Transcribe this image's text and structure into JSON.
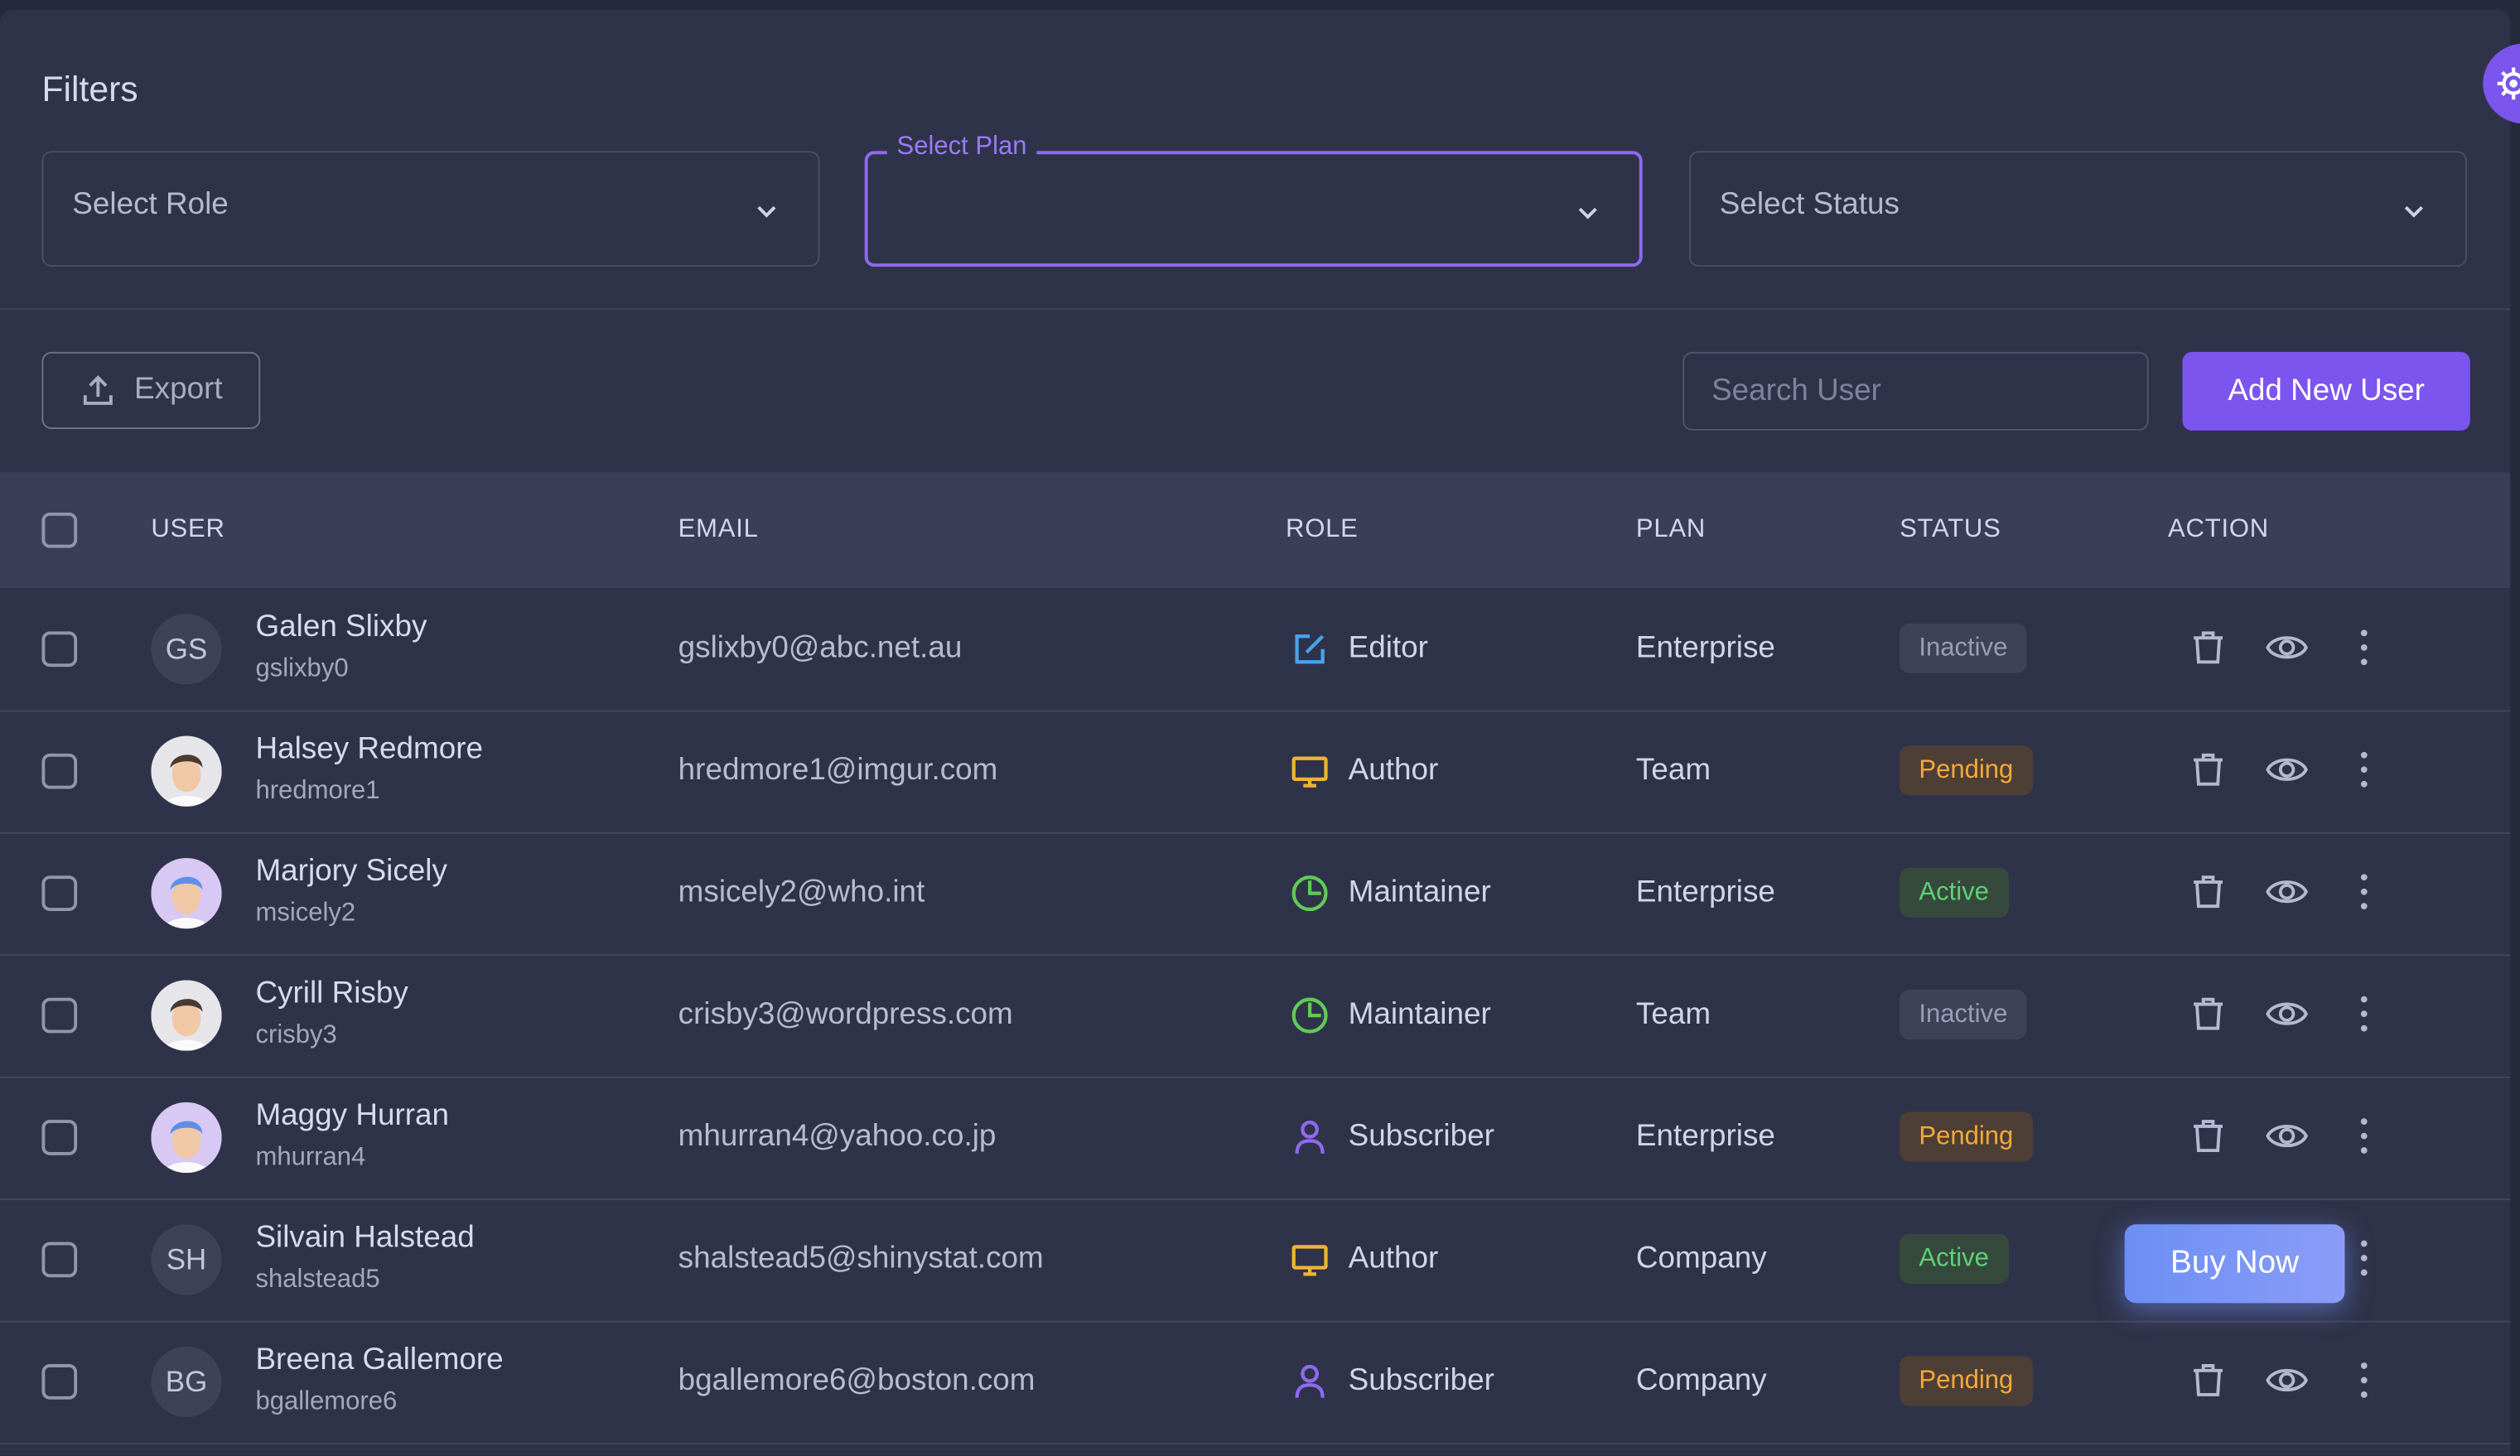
{
  "filters": {
    "title": "Filters",
    "role_placeholder": "Select Role",
    "plan_label": "Select Plan",
    "status_placeholder": "Select Status"
  },
  "toolbar": {
    "export_label": "Export",
    "search_placeholder": "Search User",
    "add_label": "Add New User"
  },
  "table": {
    "headers": {
      "user": "USER",
      "email": "EMAIL",
      "role": "ROLE",
      "plan": "PLAN",
      "status": "STATUS",
      "action": "ACTION"
    },
    "rows": [
      {
        "initials": "GS",
        "avatar": "initials",
        "name": "Galen Slixby",
        "handle": "gslixby0",
        "email": "gslixby0@abc.net.au",
        "role": "Editor",
        "role_icon": "edit-icon",
        "plan": "Enterprise",
        "status": "Inactive"
      },
      {
        "initials": "",
        "avatar": "photo-man",
        "name": "Halsey Redmore",
        "handle": "hredmore1",
        "email": "hredmore1@imgur.com",
        "role": "Author",
        "role_icon": "monitor-icon",
        "plan": "Team",
        "status": "Pending"
      },
      {
        "initials": "",
        "avatar": "photo-woman",
        "name": "Marjory Sicely",
        "handle": "msicely2",
        "email": "msicely2@who.int",
        "role": "Maintainer",
        "role_icon": "chart-pie-icon",
        "plan": "Enterprise",
        "status": "Active"
      },
      {
        "initials": "",
        "avatar": "photo-man",
        "name": "Cyrill Risby",
        "handle": "crisby3",
        "email": "crisby3@wordpress.com",
        "role": "Maintainer",
        "role_icon": "chart-pie-icon",
        "plan": "Team",
        "status": "Inactive"
      },
      {
        "initials": "",
        "avatar": "photo-woman",
        "name": "Maggy Hurran",
        "handle": "mhurran4",
        "email": "mhurran4@yahoo.co.jp",
        "role": "Subscriber",
        "role_icon": "user-icon",
        "plan": "Enterprise",
        "status": "Pending"
      },
      {
        "initials": "SH",
        "avatar": "initials",
        "name": "Silvain Halstead",
        "handle": "shalstead5",
        "email": "shalstead5@shinystat.com",
        "role": "Author",
        "role_icon": "monitor-icon",
        "plan": "Company",
        "status": "Active"
      },
      {
        "initials": "BG",
        "avatar": "initials",
        "name": "Breena Gallemore",
        "handle": "bgallemore6",
        "email": "bgallemore6@boston.com",
        "role": "Subscriber",
        "role_icon": "user-icon",
        "plan": "Company",
        "status": "Pending"
      }
    ]
  },
  "buy_now_label": "Buy Now",
  "colors": {
    "primary": "#7b55ee",
    "editor": "#4aa3f0",
    "author": "#f0b434",
    "maintainer": "#5fcb56",
    "subscriber": "#8f6af2",
    "active_bg": "#354a3c",
    "active_fg": "#5fd076",
    "pending_bg": "#4d3f35",
    "pending_fg": "#f5a93a",
    "inactive_bg": "#3e4158",
    "inactive_fg": "#9a9db6"
  }
}
